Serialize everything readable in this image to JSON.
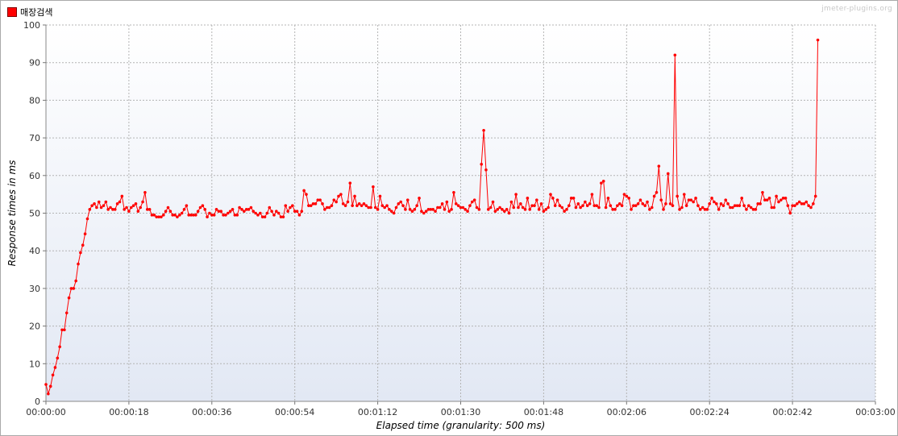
{
  "legend": {
    "label": "매장검색",
    "color": "#ff0000"
  },
  "watermark": "jmeter-plugins.org",
  "chart_data": {
    "type": "line",
    "xlabel": "Elapsed time (granularity: 500 ms)",
    "ylabel": "Response times in ms",
    "ylim": [
      0,
      100
    ],
    "yticks": [
      0,
      10,
      20,
      30,
      40,
      50,
      60,
      70,
      80,
      90,
      100
    ],
    "xlim_seconds": [
      0,
      180
    ],
    "xticks": [
      "00:00:00",
      "00:00:18",
      "00:00:36",
      "00:00:54",
      "00:01:12",
      "00:01:30",
      "00:01:48",
      "00:02:06",
      "00:02:24",
      "00:02:42",
      "00:03:00"
    ],
    "grid": true,
    "legend_position": "top-left",
    "series": [
      {
        "name": "매장검색",
        "color": "#ff0000",
        "x_step_seconds": 0.5,
        "values": [
          4.5,
          2,
          4,
          7,
          9,
          11.5,
          14.5,
          19,
          19,
          23.5,
          27.5,
          30,
          30,
          32,
          36.5,
          39.5,
          41.5,
          44.5,
          48.5,
          51,
          52,
          52.5,
          51.5,
          53,
          51.5,
          52,
          53,
          51,
          51.5,
          51,
          51,
          52.5,
          53,
          54.5,
          51,
          51.5,
          50.5,
          51.5,
          52,
          52.5,
          50.5,
          51.5,
          53,
          55.5,
          51,
          51,
          49.5,
          49.5,
          49,
          49,
          49,
          49.5,
          50.5,
          51.5,
          50.5,
          49.5,
          49.5,
          49,
          49.5,
          50,
          51,
          52,
          49.5,
          49.5,
          49.5,
          49.5,
          50.5,
          51.5,
          52,
          51,
          49,
          50,
          49.5,
          49.5,
          51,
          50.5,
          50.5,
          49.5,
          49.5,
          50,
          50.5,
          51,
          49.5,
          49.5,
          51.5,
          51,
          50.5,
          51,
          51,
          51.5,
          50.5,
          50,
          49.5,
          50,
          49,
          49,
          50,
          51.5,
          50.5,
          49.5,
          50.5,
          50,
          49,
          49,
          52,
          50.5,
          51.5,
          52,
          50.5,
          50.5,
          49.5,
          50.5,
          56,
          55,
          52,
          52,
          52.5,
          52.5,
          53.5,
          53.5,
          52.5,
          51,
          51.5,
          51.5,
          52,
          53.5,
          53,
          54.5,
          55,
          52.5,
          52,
          53,
          58,
          52,
          54.5,
          52,
          52.5,
          52,
          52.5,
          52,
          51.5,
          51.5,
          57,
          51.5,
          51,
          54.5,
          52,
          51.5,
          52,
          51,
          50.5,
          50,
          51.5,
          52.5,
          53,
          52,
          51,
          53.5,
          51,
          50.5,
          51,
          52,
          54,
          50.5,
          50,
          50.5,
          51,
          51,
          51,
          50.5,
          51.5,
          51.5,
          52.5,
          51,
          53,
          50.5,
          51,
          55.5,
          52.5,
          52,
          51.5,
          51.5,
          51,
          50.5,
          52,
          53,
          53.5,
          51.5,
          51,
          63,
          72,
          61.5,
          51,
          51.5,
          53,
          50.5,
          51,
          51.5,
          51,
          50.5,
          51,
          50,
          53,
          51.5,
          55,
          51.5,
          52.5,
          51.5,
          51,
          54,
          51,
          52,
          52,
          53.5,
          51,
          52.5,
          50.5,
          51,
          51.5,
          55,
          54,
          52,
          53.5,
          52,
          51.5,
          50.5,
          51,
          52,
          54,
          54,
          51.5,
          52.5,
          51.5,
          52,
          53,
          52,
          52.5,
          55,
          52,
          52,
          51.5,
          58,
          58.5,
          51.5,
          54,
          52,
          51,
          51,
          52,
          52.5,
          52,
          55,
          54.5,
          54,
          51,
          52,
          52,
          52.5,
          53.5,
          52.5,
          52,
          53,
          51,
          51.5,
          54.5,
          55.5,
          62.5,
          53.5,
          51,
          52.5,
          60.5,
          52.5,
          52,
          92,
          54.5,
          51,
          51.5,
          55,
          52,
          53.5,
          53.5,
          53,
          54,
          52,
          51,
          51.5,
          51,
          51,
          52.5,
          54,
          53,
          52.5,
          51,
          52.5,
          52,
          53.5,
          52.5,
          51.5,
          51.5,
          52,
          52,
          52,
          54,
          52,
          51,
          52,
          51.5,
          51,
          51,
          52.5,
          52.5,
          55.5,
          53.5,
          53.5,
          54,
          51.5,
          51.5,
          54.5,
          53,
          53.5,
          54,
          54,
          52,
          50,
          52,
          52,
          52.5,
          53,
          52.5,
          52.5,
          53,
          52,
          51.5,
          52.5,
          54.5,
          96
        ]
      }
    ]
  }
}
